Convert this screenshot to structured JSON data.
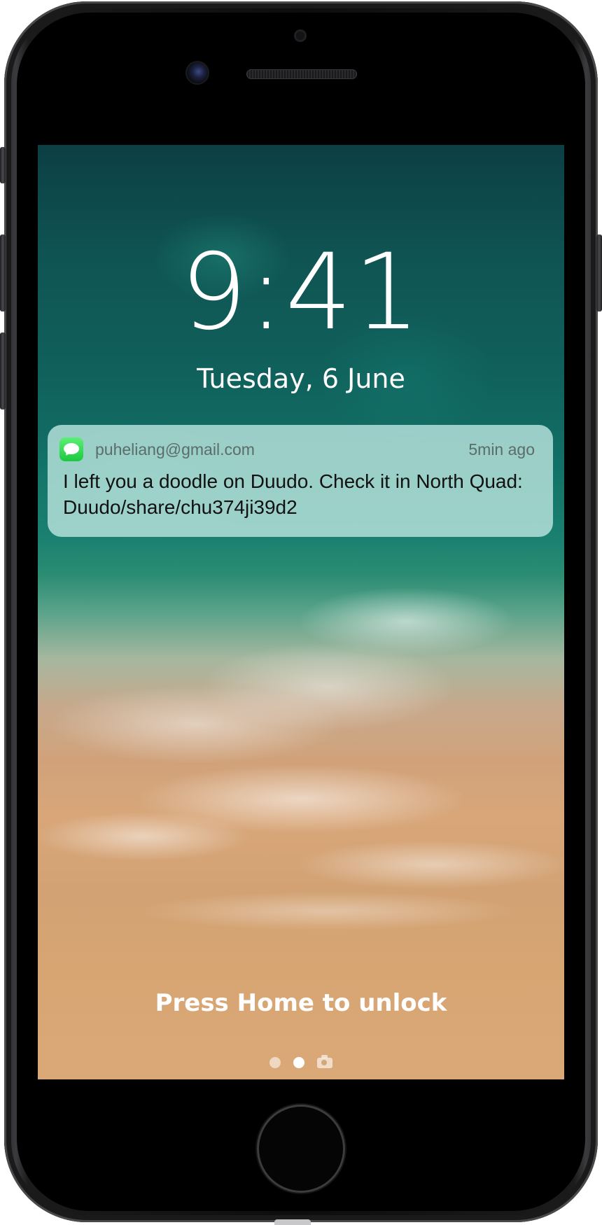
{
  "lock_screen": {
    "time": "9:41",
    "date": "Tuesday, 6 June",
    "unlock_hint": "Press Home to unlock"
  },
  "notification": {
    "app_icon": "messages-icon",
    "sender": "puheliang@gmail.com",
    "time_ago": "5min ago",
    "message": "I left you a doodle on Duudo. Check it in North Quad: Duudo/share/chu374ji39d2"
  },
  "page_indicator": {
    "pages": 3,
    "active_index": 1,
    "last_icon": "camera-icon"
  },
  "colors": {
    "notification_background": "#bae4de",
    "messages_green": "#1bc93e"
  }
}
